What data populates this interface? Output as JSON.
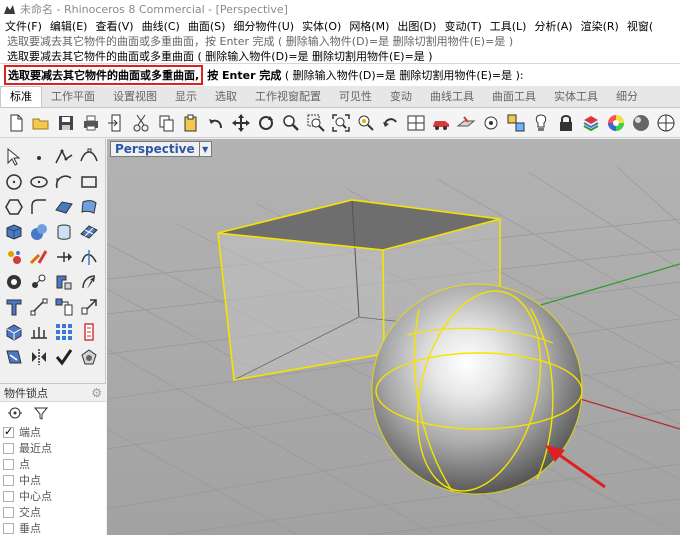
{
  "window": {
    "title": "未命名 - Rhinoceros 8 Commercial - [Perspective]"
  },
  "menu": [
    "文件(F)",
    "编辑(E)",
    "查看(V)",
    "曲线(C)",
    "曲面(S)",
    "细分物件(U)",
    "实体(O)",
    "网格(M)",
    "出图(D)",
    "变动(T)",
    "工具(L)",
    "分析(A)",
    "渲染(R)",
    "视窗("
  ],
  "command": {
    "history": [
      "选取要减去其它物件的曲面或多重曲面，按 Enter 完成 ( 删除输入物件(D)=是 删除切割用物件(E)=是 )",
      "选取要减去其它物件的曲面或多重曲面 ( 删除输入物件(D)=是   删除切割用物件(E)=是 )"
    ],
    "prompt_highlight": "选取要减去其它物件的曲面或多重曲面,",
    "prompt_enter": "按 Enter 完成",
    "prompt_options": "( 删除输入物件(D)=是   删除切割用物件(E)=是 ):"
  },
  "tabs": [
    "标准",
    "工作平面",
    "设置视图",
    "显示",
    "选取",
    "工作视窗配置",
    "可见性",
    "变动",
    "曲线工具",
    "曲面工具",
    "实体工具",
    "细分"
  ],
  "active_tab": "标准",
  "viewport": {
    "name": "Perspective"
  },
  "osnap": {
    "title": "物件锁点",
    "items": [
      {
        "label": "端点",
        "checked": true
      },
      {
        "label": "最近点",
        "checked": false
      },
      {
        "label": "点",
        "checked": false
      },
      {
        "label": "中点",
        "checked": false
      },
      {
        "label": "中心点",
        "checked": false
      },
      {
        "label": "交点",
        "checked": false
      },
      {
        "label": "垂点",
        "checked": false
      }
    ]
  },
  "colors": {
    "selection_yellow": "#f5e300",
    "annotation_red": "#e02020",
    "viewport_bg": "#a7a7a7",
    "x_axis": "#b02a2a",
    "y_axis": "#2e9a2e"
  }
}
